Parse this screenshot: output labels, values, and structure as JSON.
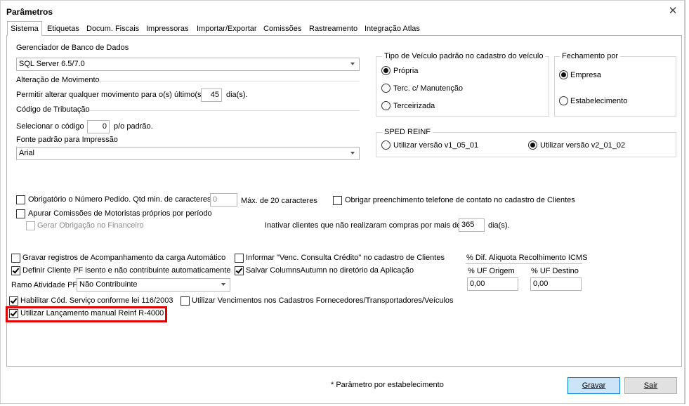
{
  "window": {
    "title": "Parâmetros",
    "close_glyph": "✕"
  },
  "tabs": [
    "Sistema",
    "Etiquetas",
    "Docum. Fiscais",
    "Impressoras",
    "Importar/Exportar",
    "Comissões",
    "Rastreamento",
    "Integração Atlas"
  ],
  "db": {
    "label": "Gerenciador de Banco de Dados",
    "value": "SQL Server 6.5/7.0"
  },
  "movimento": {
    "label": "Alteração de Movimento",
    "text_before": "Permitir alterar qualquer movimento para o(s) último(s)",
    "value": "45",
    "text_after": "dia(s)."
  },
  "tributacao": {
    "label": "Código de Tributação",
    "text_before": "Selecionar o código",
    "value": "0",
    "text_after": "p/o padrão."
  },
  "fonte": {
    "label": "Fonte padrão para Impressão",
    "value": "Arial"
  },
  "veiculo": {
    "legend": "Tipo de Veículo padrão no cadastro do veículo",
    "options": [
      "Própria",
      "Terc. c/ Manutenção",
      "Terceirizada"
    ],
    "selected": "Própria"
  },
  "fechamento": {
    "legend": "Fechamento por",
    "options": [
      "Empresa",
      "Estabelecimento"
    ],
    "selected": "Empresa"
  },
  "sped": {
    "legend": "SPED REINF",
    "options": [
      "Utilizar versão v1_05_01",
      "Utilizar versão v2_01_02"
    ],
    "selected": "Utilizar versão v2_01_02"
  },
  "pedido": {
    "label": "Obrigatório o Número Pedido. Qtd min. de caracteres",
    "value": "0",
    "max_text": "Máx. de 20 caracteres",
    "checked": false
  },
  "telefone": {
    "label": "Obrigar preenchimento telefone de contato no cadastro de Clientes",
    "checked": false
  },
  "comissoes": {
    "label": "Apurar Comissões de Motoristas próprios por período",
    "checked": false
  },
  "obrigacao": {
    "label": "Gerar Obrigação no Financeiro",
    "checked": false,
    "disabled": true
  },
  "inativar": {
    "text_before": "Inativar clientes que não realizaram compras por mais de",
    "value": "365",
    "text_after": "dia(s)."
  },
  "checks": {
    "gravar": {
      "label": "Gravar registros de Acompanhamento da carga Automático",
      "checked": false
    },
    "informar": {
      "label": "Informar \"Venc. Consulta Crédito\" no cadastro de Clientes",
      "checked": false
    },
    "definir": {
      "label": "Definir Cliente PF isento e não contribuinte automaticamente",
      "checked": true
    },
    "salvar": {
      "label": "Salvar ColumnsAutumn no diretório da Aplicação",
      "checked": true
    },
    "habilitar": {
      "label": "Habilitar Cód. Serviço conforme lei 116/2003",
      "checked": true
    },
    "vencimentos": {
      "label": "Utilizar Vencimentos nos Cadastros Fornecedores/Transportadores/Veículos",
      "checked": false
    },
    "reinf": {
      "label": "Utilizar Lançamento manual Reinf R-4000",
      "checked": true
    }
  },
  "ramo": {
    "label": "Ramo Atividade PF",
    "value": "Não Contribuinte"
  },
  "icms": {
    "title": "% Dif. Aliquota Recolhimento ICMS",
    "origem_label": "% UF Origem",
    "destino_label": "% UF Destino",
    "origem_value": "0,00",
    "destino_value": "0,00"
  },
  "footer": {
    "note": "* Parâmetro por estabelecimento",
    "save": "Gravar",
    "exit": "Sair"
  },
  "colors": {
    "highlight": "#e00000",
    "primary_button": "#cce4f7"
  }
}
